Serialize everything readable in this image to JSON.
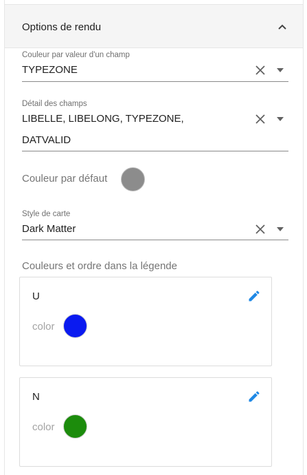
{
  "panel": {
    "title": "Options de rendu"
  },
  "fields": {
    "color_by_field": {
      "label": "Couleur par valeur d'un champ",
      "value": "TYPEZONE"
    },
    "detail_fields": {
      "label": "Détail des champs",
      "line1": "LIBELLE,  LIBELONG,  TYPEZONE,",
      "line2": "DATVALID"
    },
    "map_style": {
      "label": "Style de carte",
      "value": "Dark Matter"
    }
  },
  "default_color": {
    "label": "Couleur par défaut",
    "color": "#8c8c8c"
  },
  "legend": {
    "heading": "Couleurs et ordre dans la légende",
    "items": [
      {
        "name": "U",
        "color_label": "color",
        "color": "#0a1af0"
      },
      {
        "name": "N",
        "color_label": "color",
        "color": "#1c8c0c"
      }
    ]
  },
  "colors": {
    "accent": "#1e88e5",
    "header_bg": "#f5f5f5"
  },
  "icons": {
    "collapse": "chevron-up-icon",
    "clear": "close-icon",
    "dropdown": "caret-down-icon",
    "edit": "pencil-icon"
  }
}
